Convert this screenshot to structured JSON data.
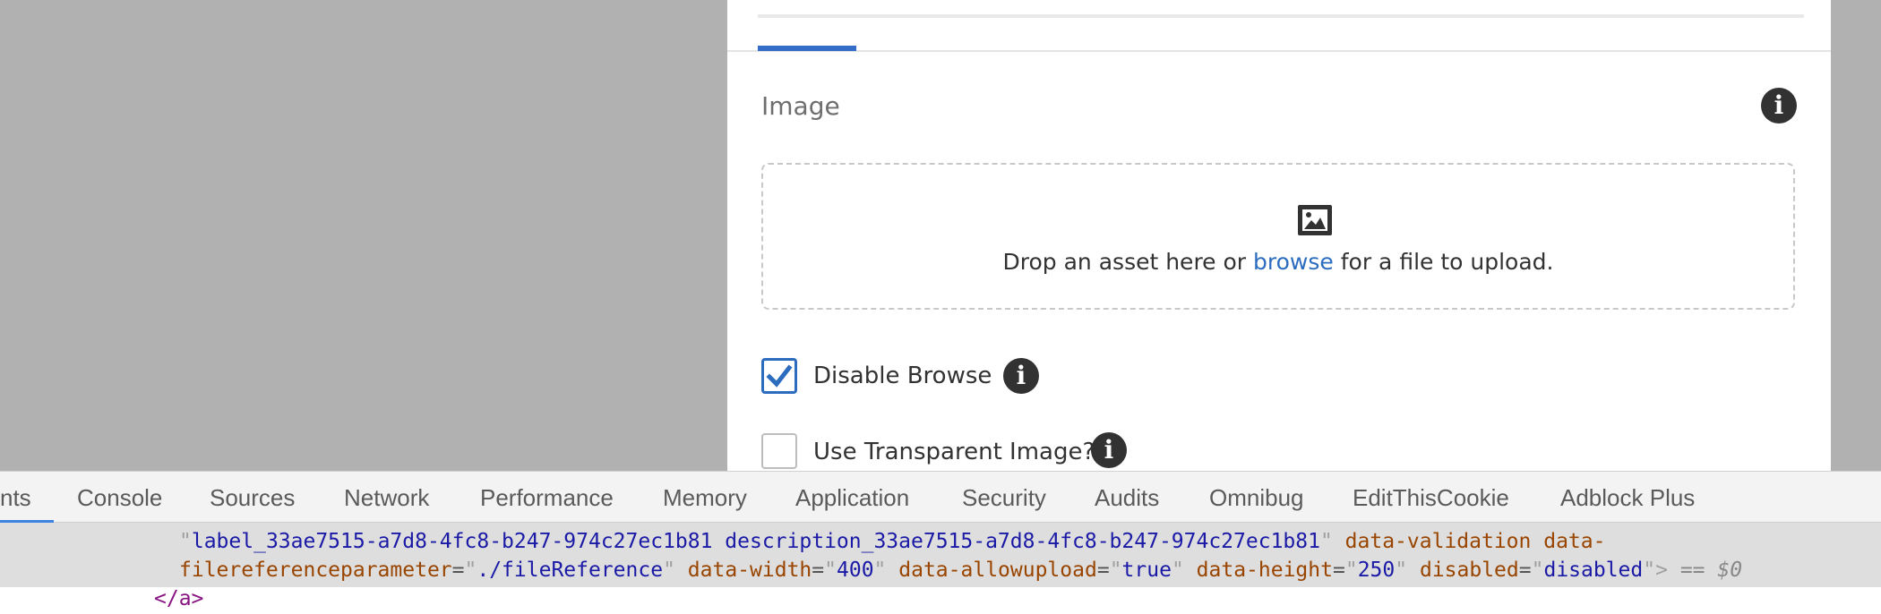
{
  "dialog": {
    "image_field": {
      "label": "Image"
    },
    "dropzone": {
      "text_before": "Drop an asset here or ",
      "link_text": "browse",
      "text_after": " for a file to upload."
    },
    "disable_browse": {
      "label": "Disable Browse",
      "checked": true
    },
    "use_transparent": {
      "label": "Use Transparent Image?",
      "checked": false
    },
    "info_glyph": "i"
  },
  "devtools": {
    "tabs": [
      {
        "label": "nts",
        "active": true
      },
      {
        "label": "Console"
      },
      {
        "label": "Sources"
      },
      {
        "label": "Network"
      },
      {
        "label": "Performance"
      },
      {
        "label": "Memory"
      },
      {
        "label": "Application"
      },
      {
        "label": "Security"
      },
      {
        "label": "Audits"
      },
      {
        "label": "Omnibug"
      },
      {
        "label": "EditThisCookie"
      },
      {
        "label": "Adblock Plus"
      }
    ],
    "code": {
      "line1_value": "label_33ae7515-a7d8-4fc8-b247-974c27ec1b81 description_33ae7515-a7d8-4fc8-b247-974c27ec1b81",
      "line1_attr": "data-validation data-",
      "line2_attr1": "filereferenceparameter",
      "line2_val1": "./fileReference",
      "line2_attr2": "data-width",
      "line2_val2": "400",
      "line2_attr3": "data-allowupload",
      "line2_val3": "true",
      "line2_attr4": "data-height",
      "line2_val4": "250",
      "line2_attr5": "disabled",
      "line2_val5": "disabled",
      "selected_marker": "== $0",
      "closing_tag": "</a>"
    }
  },
  "colors": {
    "accent": "#2b6cbf",
    "backdrop": "#b1b1b1",
    "info_icon": "#323232"
  }
}
